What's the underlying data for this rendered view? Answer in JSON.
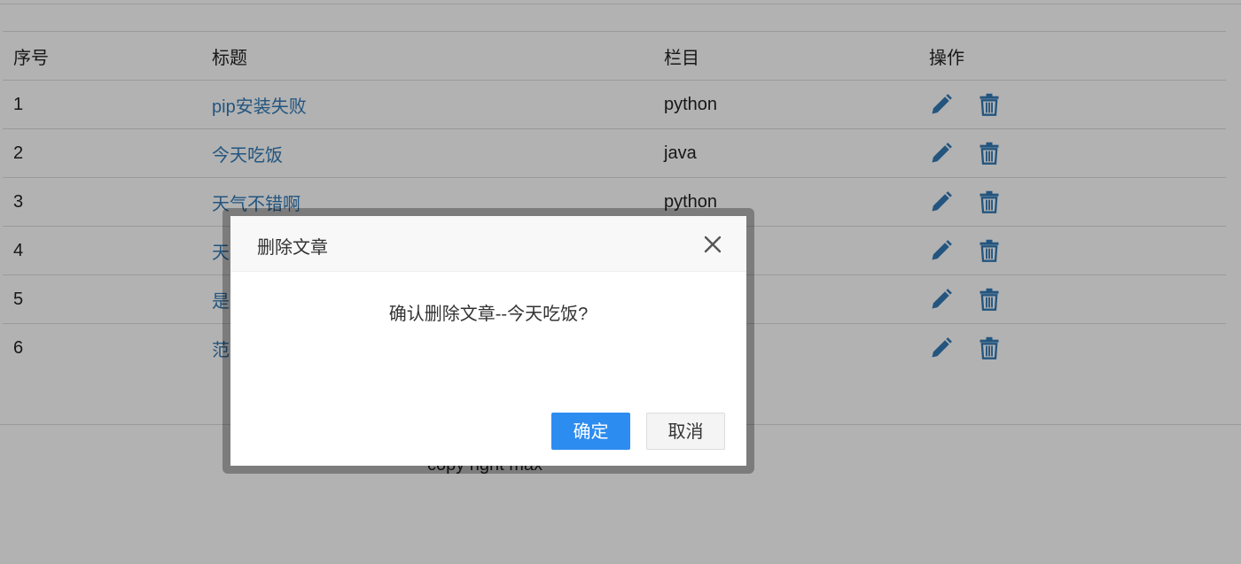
{
  "table": {
    "headers": [
      "序号",
      "标题",
      "栏目",
      "操作"
    ],
    "rows": [
      {
        "no": "1",
        "title": "pip安装失败",
        "category": "python"
      },
      {
        "no": "2",
        "title": "今天吃饭",
        "category": "java"
      },
      {
        "no": "3",
        "title": "天气不错啊",
        "category": "python"
      },
      {
        "no": "4",
        "title": "天",
        "category": ""
      },
      {
        "no": "5",
        "title": "是",
        "category": ""
      },
      {
        "no": "6",
        "title": "范",
        "category": ""
      }
    ],
    "actions": {
      "edit_icon": "pencil-icon",
      "delete_icon": "trash-icon"
    }
  },
  "footer": {
    "copyright": "copy right max"
  },
  "dialog": {
    "title": "删除文章",
    "message": "确认删除文章--今天吃饭?",
    "ok_label": "确定",
    "cancel_label": "取消",
    "close_icon": "close-icon"
  },
  "colors": {
    "link": "#337ab7",
    "primary_button": "#2d8cf0",
    "overlay": "rgba(0,0,0,0.3)"
  }
}
